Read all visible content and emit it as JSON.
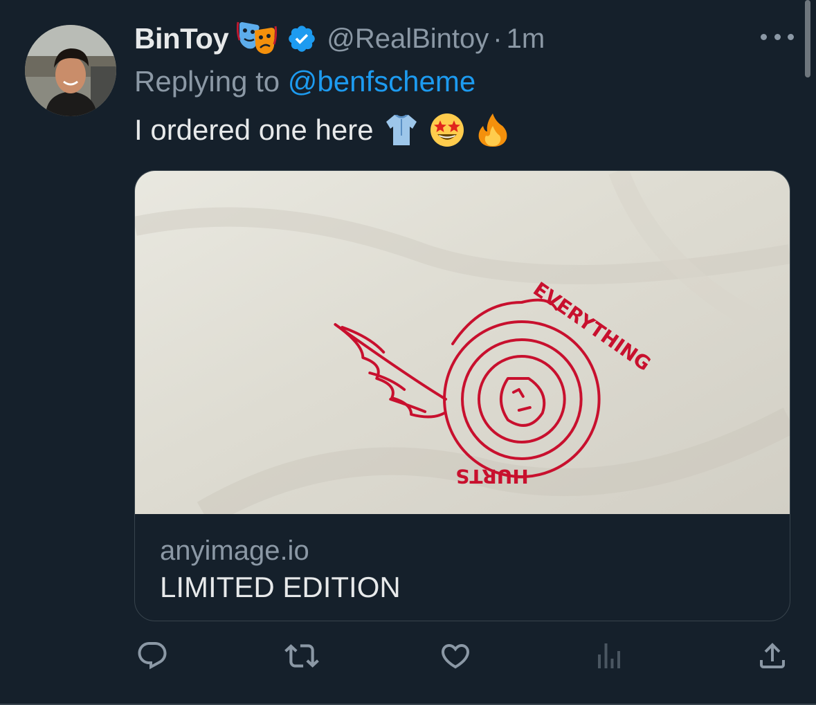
{
  "tweet": {
    "display_name": "BinToy",
    "name_emoji": "performing-arts-emoji",
    "handle": "@RealBintoy",
    "separator": "·",
    "time": "1m",
    "reply_prefix": "Replying to",
    "reply_to": "@benfscheme",
    "text": "I ordered one here",
    "text_emojis": [
      "t-shirt-emoji",
      "star-struck-emoji",
      "fire-emoji"
    ]
  },
  "card": {
    "domain": "anyimage.io",
    "title": "LIMITED EDITION",
    "logo_text_top": "EVERYTHING",
    "logo_text_bottom": "HURTS"
  },
  "actions": [
    "reply-icon",
    "retweet-icon",
    "like-icon",
    "views-icon",
    "share-icon"
  ],
  "colors": {
    "background": "#15202b",
    "text": "#e7e9ea",
    "secondary_text": "#8b98a5",
    "link": "#1d9bf0",
    "border": "#38444d",
    "print_red": "#c8102e"
  }
}
